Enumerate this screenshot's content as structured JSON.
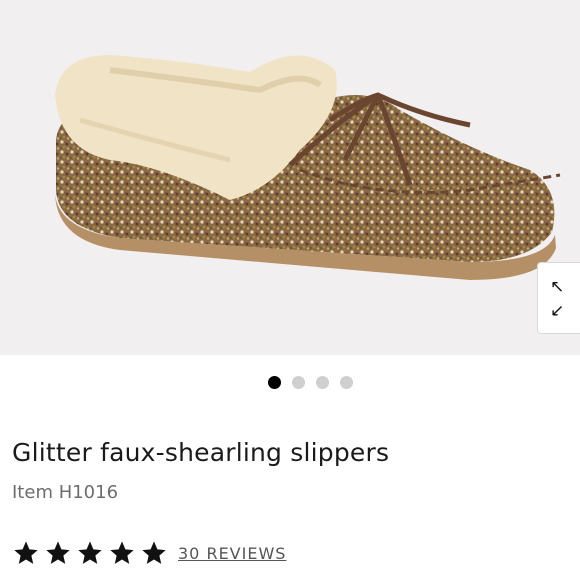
{
  "product": {
    "title": "Glitter faux-shearling slippers",
    "item_number": "Item H1016",
    "rating_stars": 5,
    "reviews_link": "30 REVIEWS"
  },
  "gallery": {
    "image_alt": "product-photo-glitter-slipper",
    "expand_icons": [
      "↖",
      "↙"
    ],
    "dot_count": 4,
    "active_dot": 0
  },
  "colors": {
    "star": "#111111",
    "active_dot": "#000000",
    "inactive_dot": "#cfcfcf"
  }
}
